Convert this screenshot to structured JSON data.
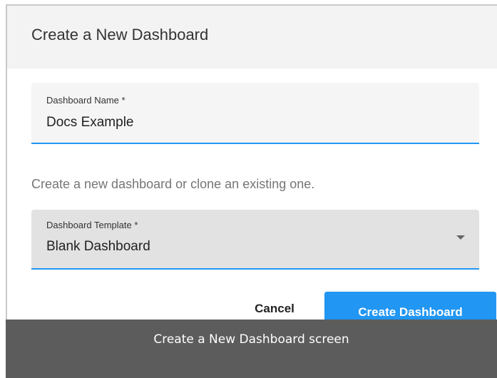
{
  "dialog": {
    "title": "Create a New Dashboard",
    "name_field": {
      "label": "Dashboard Name *",
      "value": "Docs Example"
    },
    "help_text": "Create a new dashboard or clone an existing one.",
    "template_field": {
      "label": "Dashboard Template *",
      "selected": "Blank Dashboard"
    },
    "buttons": {
      "cancel": "Cancel",
      "create": "Create Dashboard"
    }
  },
  "caption": "Create a New Dashboard screen",
  "colors": {
    "accent": "#2196f3",
    "caption_bg": "#5c5c5c"
  }
}
